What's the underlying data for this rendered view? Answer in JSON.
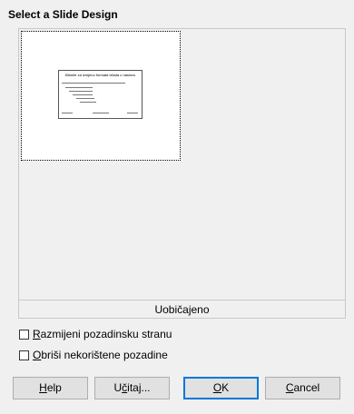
{
  "dialog": {
    "title": "Select a Slide Design"
  },
  "designs": {
    "selected_label": "Uobičajeno",
    "thumbnail": {
      "slide_title": "Kliknite za izmjenu formata teksta u naslovu",
      "outline_first": "Kliknite za izmjenu formata teksta u nacrtu"
    }
  },
  "options": {
    "exchange_background": {
      "pre": "",
      "mn": "R",
      "post": "azmijeni pozadinsku stranu",
      "checked": false
    },
    "delete_unused": {
      "pre": "",
      "mn": "O",
      "post": "briši nekorištene pozadine",
      "checked": false
    }
  },
  "buttons": {
    "help": {
      "mn": "H",
      "post": "elp"
    },
    "load": {
      "pre": "U",
      "mn": "č",
      "post": "itaj..."
    },
    "ok": {
      "mn": "O",
      "post": "K"
    },
    "cancel": {
      "mn": "C",
      "post": "ancel"
    }
  }
}
